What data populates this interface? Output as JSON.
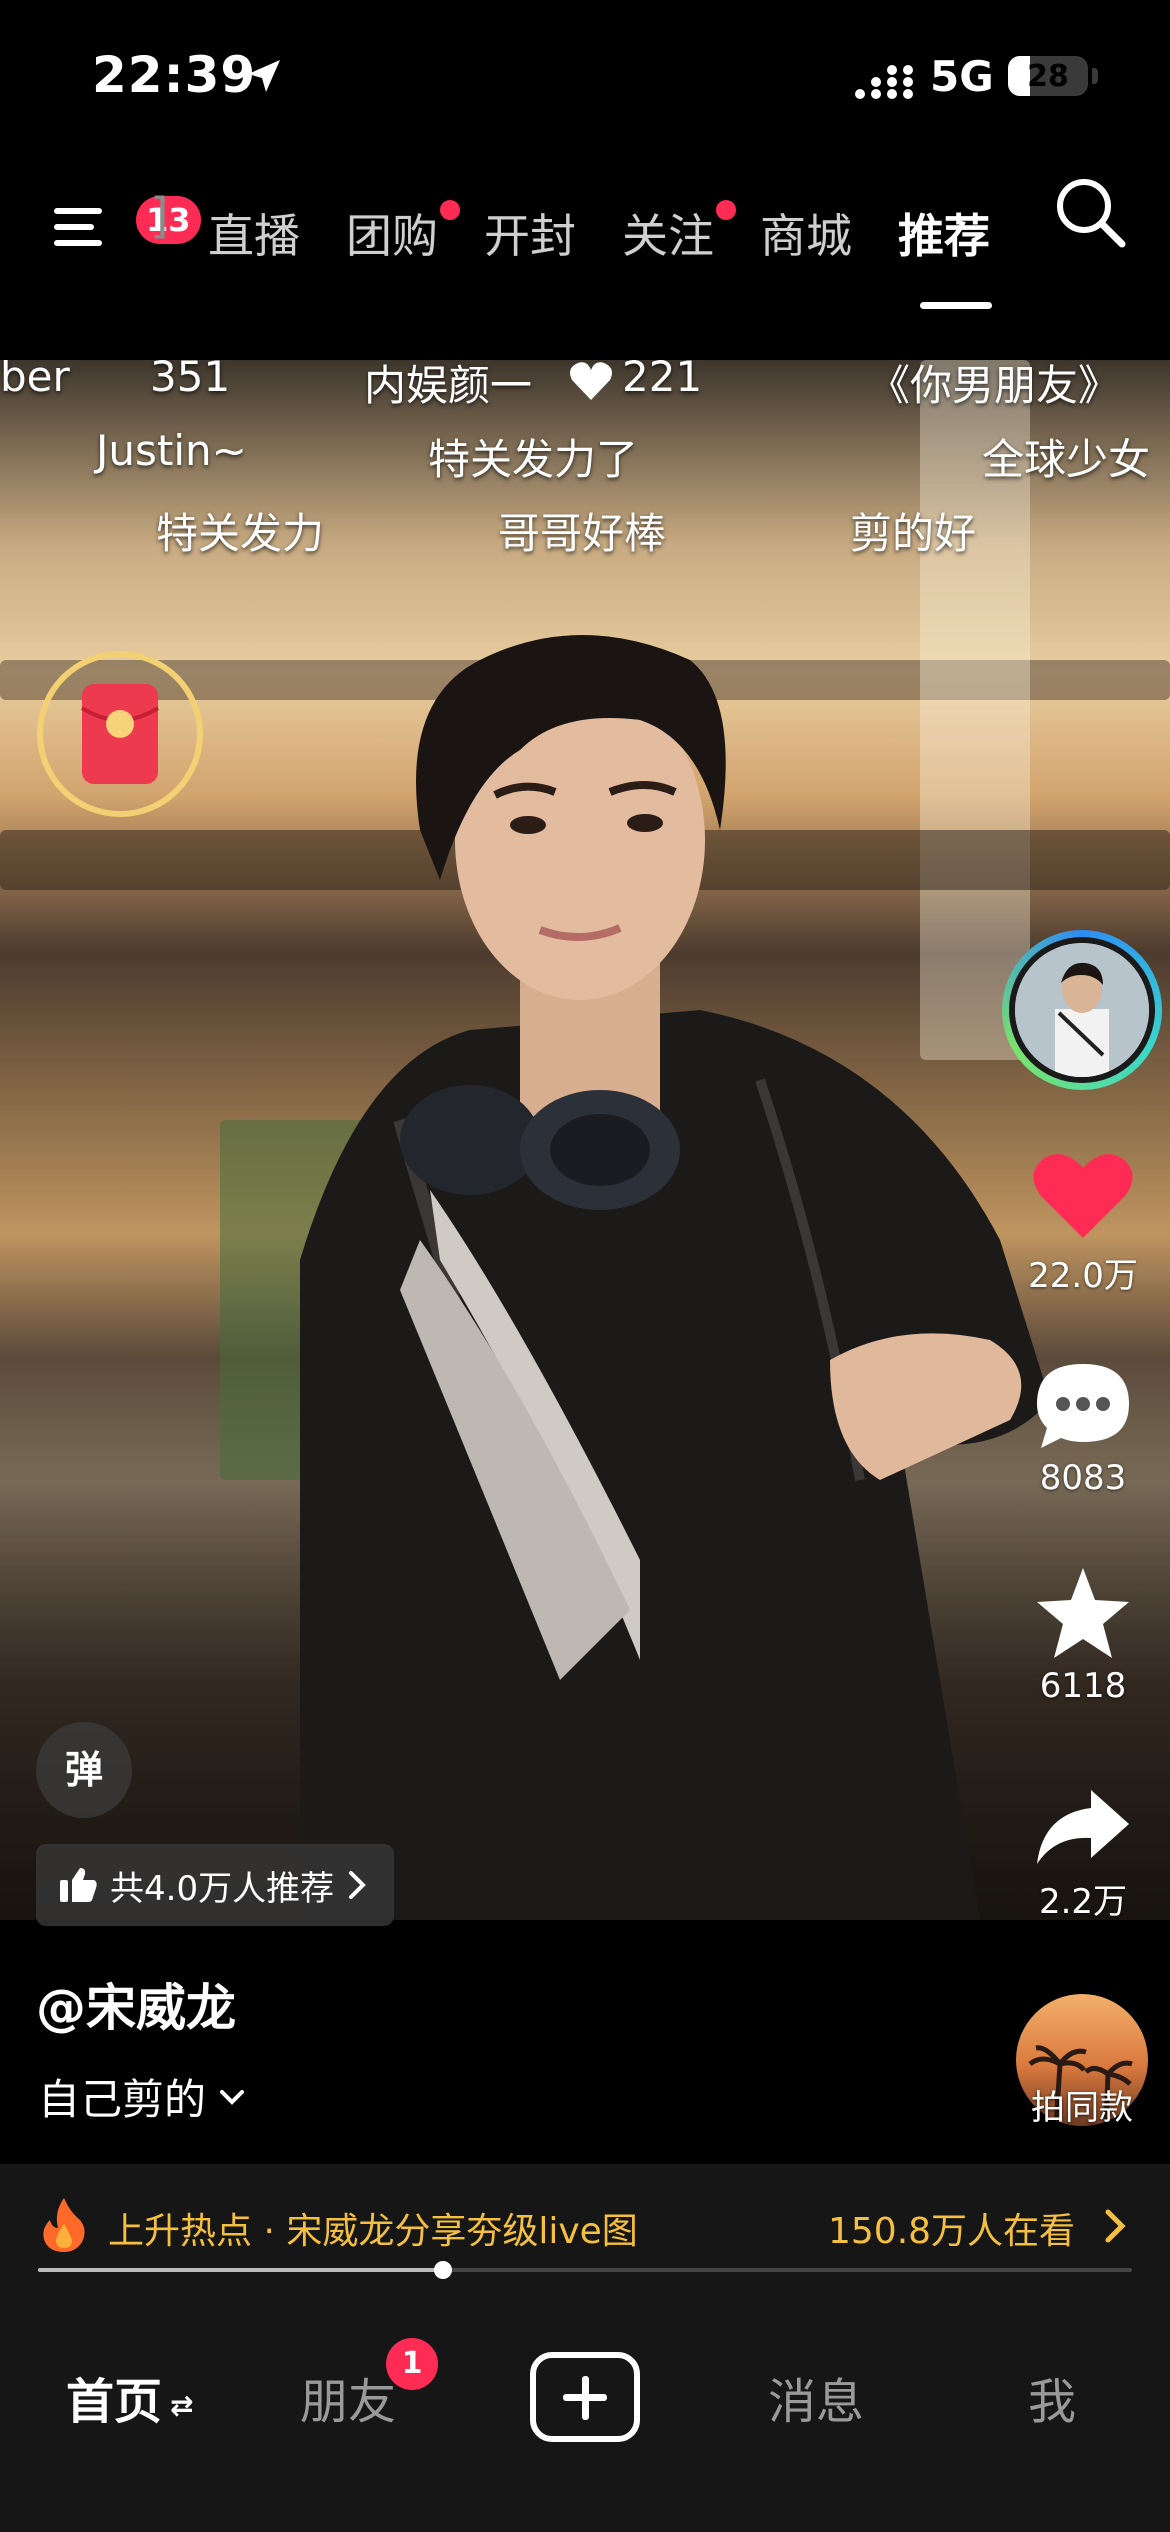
{
  "status_bar": {
    "time": "22:39",
    "network": "5G",
    "battery": "28",
    "battery_level": 0.28
  },
  "top_nav": {
    "menu_badge": "13",
    "truncated_tab": "]",
    "tabs": [
      {
        "label": "直播",
        "active": false,
        "dot": false
      },
      {
        "label": "团购",
        "active": false,
        "dot": true
      },
      {
        "label": "开封",
        "active": false,
        "dot": false
      },
      {
        "label": "关注",
        "active": false,
        "dot": true
      },
      {
        "label": "商城",
        "active": false,
        "dot": false
      },
      {
        "label": "推荐",
        "active": true,
        "dot": false
      }
    ]
  },
  "danmaku": [
    {
      "text": "ber",
      "row": 1
    },
    {
      "text": "351",
      "row": 1
    },
    {
      "text": "内娱颜一",
      "row": 1
    },
    {
      "text": "221",
      "row": 1
    },
    {
      "text": "《你男朋友》",
      "row": 1
    },
    {
      "text": "Justin~",
      "row": 2
    },
    {
      "text": "特关发力了",
      "row": 2
    },
    {
      "text": "全球少女",
      "row": 2
    },
    {
      "text": "特关发力",
      "row": 3
    },
    {
      "text": "哥哥好棒",
      "row": 3
    },
    {
      "text": "剪的好",
      "row": 3
    }
  ],
  "actions": {
    "like_count": "22.0万",
    "comment_count": "8083",
    "favorite_count": "6118",
    "share_count": "2.2万"
  },
  "overlay": {
    "danmaku_toggle": "弹",
    "recommend_text": "共4.0万人推荐",
    "author": "@宋威龙",
    "caption": "自己剪的",
    "same_style_label": "拍同款"
  },
  "hot_bar": {
    "title": "上升热点 · 宋威龙分享夯级live图",
    "viewers": "150.8万人在看"
  },
  "progress": 0.37,
  "bottom_tabs": {
    "home": "首页",
    "friends": "朋友",
    "friends_badge": "1",
    "messages": "消息",
    "me": "我"
  },
  "colors": {
    "accent_red": "#fe2c55",
    "hot_yellow": "#f5c040"
  }
}
